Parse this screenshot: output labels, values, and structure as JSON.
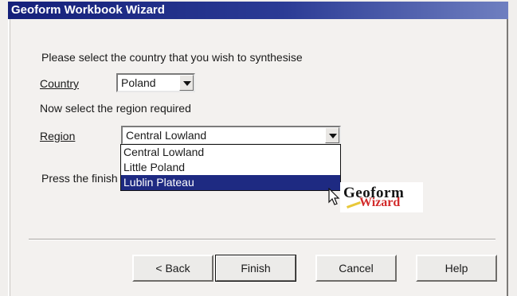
{
  "window": {
    "title": "Geoform Workbook Wizard"
  },
  "instructions": {
    "select_country": "Please select the country that you wish to synthesise",
    "select_region": "Now select the region required",
    "press_finish": "Press the finish"
  },
  "country": {
    "label": "Country",
    "selected": "Poland"
  },
  "region": {
    "label": "Region",
    "selected": "Central Lowland",
    "options": [
      "Central Lowland",
      "Little Poland",
      "Lublin Plateau"
    ],
    "highlighted_index": 2
  },
  "logo": {
    "line1": "Geoform",
    "line2": "Wizard"
  },
  "buttons": {
    "back": "< Back",
    "finish": "Finish",
    "cancel": "Cancel",
    "help": "Help"
  },
  "colors": {
    "titlebar": "#15207a",
    "selection": "#1e2a82",
    "logo_accent": "#d22b2b"
  }
}
